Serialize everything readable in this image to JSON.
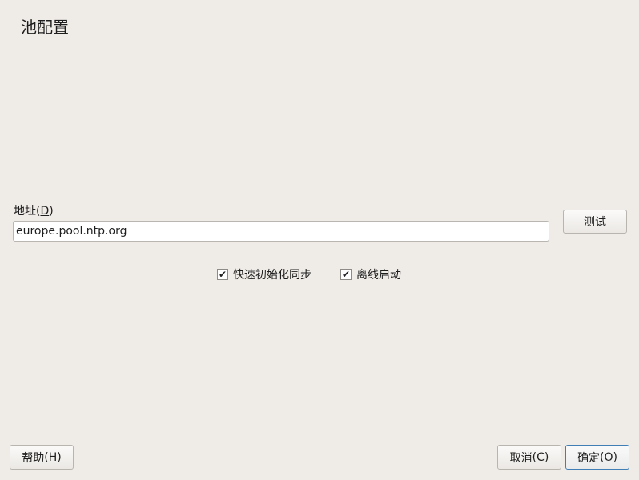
{
  "dialog": {
    "title": "池配置"
  },
  "address": {
    "label": "地址",
    "mnemonic": "D",
    "value": "europe.pool.ntp.org"
  },
  "test_button": {
    "label": "测试"
  },
  "options": [
    {
      "label": "快速初始化同步",
      "checked": true
    },
    {
      "label": "离线启动",
      "checked": true
    }
  ],
  "footer": {
    "help": {
      "label": "帮助",
      "mnemonic": "H"
    },
    "cancel": {
      "label": "取消",
      "mnemonic": "C"
    },
    "ok": {
      "label": "确定",
      "mnemonic": "O"
    }
  },
  "colors": {
    "default_button_border": "#3f7fb5",
    "background": "#efebe7"
  }
}
